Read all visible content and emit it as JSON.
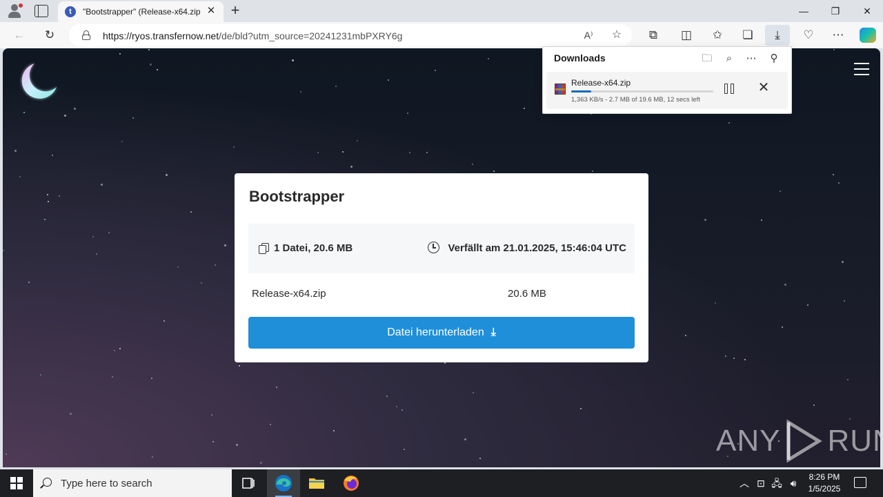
{
  "browser": {
    "tab": {
      "title": "\"Bootstrapper\" (Release-x64.zip)",
      "favicon": "t"
    },
    "address": {
      "url_host": "https://ryos.transfernow.net",
      "url_rest": "/de/bld?utm_source=20241231mbPXRY6g"
    }
  },
  "downloads_panel": {
    "title": "Downloads",
    "item": {
      "filename": "Release-x64.zip",
      "status": "1,363 KB/s - 2.7 MB of 19.6 MB, 12 secs left",
      "progress_fraction": 0.14
    }
  },
  "page": {
    "card": {
      "title": "Bootstrapper",
      "files_summary": "1 Datei, 20.6 MB",
      "expiry": "Verfällt am 21.01.2025, 15:46:04 UTC",
      "file": {
        "name": "Release-x64.zip",
        "size": "20.6 MB"
      },
      "download_button": "Datei herunterladen"
    },
    "watermark": {
      "left": "ANY",
      "right": "RUN"
    }
  },
  "taskbar": {
    "search_placeholder": "Type here to search",
    "time": "8:26 PM",
    "date": "1/5/2025"
  },
  "colors": {
    "accent": "#1f8fd9",
    "progress": "#0f6cbd",
    "taskbar": "#1d1f23"
  }
}
